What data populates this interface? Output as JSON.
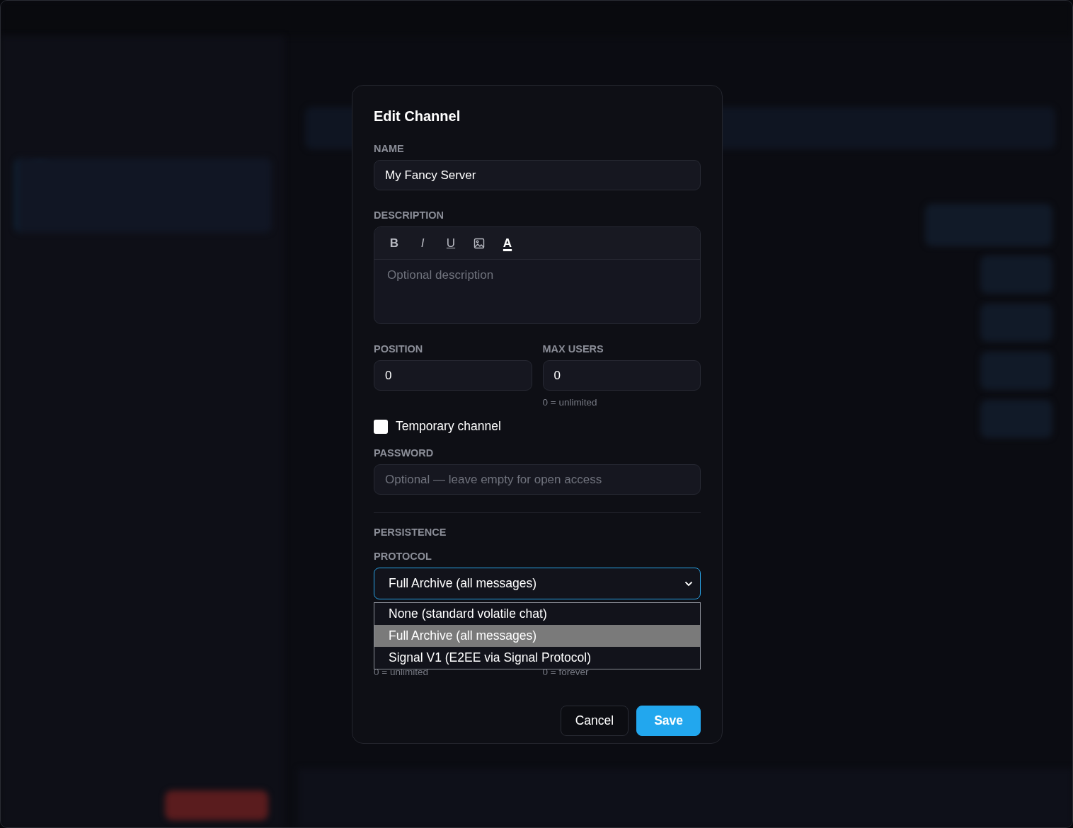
{
  "dialog": {
    "title": "Edit Channel"
  },
  "name": {
    "label": "NAME",
    "value": "My Fancy Server"
  },
  "description": {
    "label": "DESCRIPTION",
    "placeholder": "Optional description",
    "toolbar": [
      {
        "kind": "bold",
        "label": "B"
      },
      {
        "kind": "italic",
        "label": "I"
      },
      {
        "kind": "underline",
        "label": "U"
      },
      {
        "kind": "image"
      },
      {
        "kind": "color",
        "label": "A"
      }
    ]
  },
  "position": {
    "label": "POSITION",
    "value": "0"
  },
  "max_users": {
    "label": "MAX USERS",
    "value": "0",
    "hint": "0 = unlimited"
  },
  "temporary": {
    "label": "Temporary channel",
    "checked": false
  },
  "password": {
    "label": "PASSWORD",
    "placeholder": "Optional — leave empty for open access"
  },
  "persistence": {
    "heading": "PERSISTENCE",
    "protocol_label": "PROTOCOL",
    "value": "Full Archive (all messages)",
    "expanded": true,
    "options": [
      {
        "label": "None (standard volatile chat)",
        "selected": false
      },
      {
        "label": "Full Archive (all messages)",
        "selected": true
      },
      {
        "label": "Signal V1 (E2EE via Signal Protocol)",
        "selected": false
      }
    ],
    "hints": [
      "0 = unlimited",
      "0 = forever"
    ]
  },
  "buttons": [
    {
      "kind": "secondary",
      "label": "Cancel"
    },
    {
      "kind": "primary",
      "label": "Save"
    }
  ]
}
